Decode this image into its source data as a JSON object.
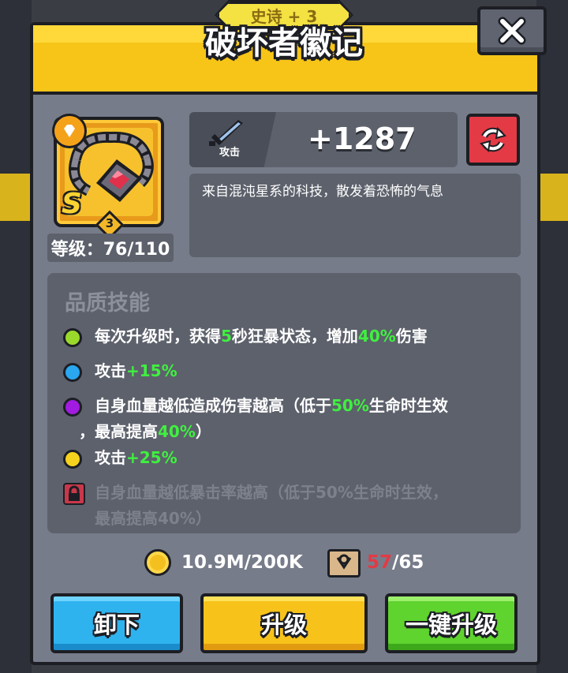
{
  "item": {
    "rarity": "史诗 + 3",
    "name": "破坏者徽记",
    "grade": "S",
    "star_level": "3",
    "level_text": "等级：76/110",
    "stat_name": "攻击",
    "stat_value": "+1287",
    "description": "来自混沌星系的科技，散发着恐怖的气息"
  },
  "skills": {
    "title": "品质技能",
    "items": [
      {
        "color": "#9ad92c",
        "parts": [
          "每次升级时，获得",
          "5",
          "秒狂暴状态，增加",
          "40%",
          "伤害"
        ]
      },
      {
        "color": "#2aa7ef",
        "parts": [
          "攻击",
          "+15%"
        ]
      },
      {
        "color": "#a21be0",
        "line1": [
          "自身血量越低造成伤害越高（低于",
          "50%",
          "生命时生效"
        ],
        "line2": [
          "，最高提高",
          "40%",
          "）"
        ]
      },
      {
        "color": "#f5d21e",
        "parts": [
          "攻击",
          "+25%"
        ]
      },
      {
        "locked": true,
        "line1": "自身血量越低暴击率越高（低于50%生命时生效，",
        "line2": "最高提高40%）"
      }
    ]
  },
  "resources": {
    "gold": "10.9M/200K",
    "scroll_have": "57",
    "scroll_need": "/65"
  },
  "buttons": {
    "unequip": "卸下",
    "upgrade": "升级",
    "upgrade_all": "一键升级"
  },
  "icons": {
    "close": "close-icon",
    "reroll": "reroll-icon",
    "sword": "sword-icon",
    "coin": "coin-icon",
    "scroll": "scroll-icon",
    "lock": "lock-icon"
  },
  "colors": {
    "header": "#f7c518",
    "panel": "#777c8a",
    "highlight": "#3ff03f",
    "red": "#e33a45"
  }
}
